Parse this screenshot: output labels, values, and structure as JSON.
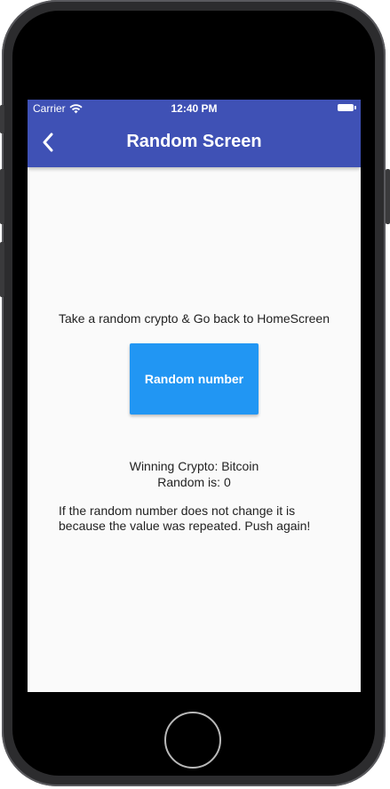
{
  "status_bar": {
    "carrier": "Carrier",
    "time": "12:40 PM",
    "wifi_icon": "wifi-icon",
    "battery_icon": "battery-icon"
  },
  "app_bar": {
    "title": "Random Screen",
    "back_icon": "chevron-left-icon",
    "background": "#3f51b5"
  },
  "main": {
    "instruction": "Take a random crypto & Go back to HomeScreen",
    "button_label": "Random number",
    "button_color": "#2196f3",
    "winning": "Winning Crypto: Bitcoin",
    "random_is": "Random is: 0",
    "note": "If the random number does not change it is because the value was repeated. Push again!"
  }
}
